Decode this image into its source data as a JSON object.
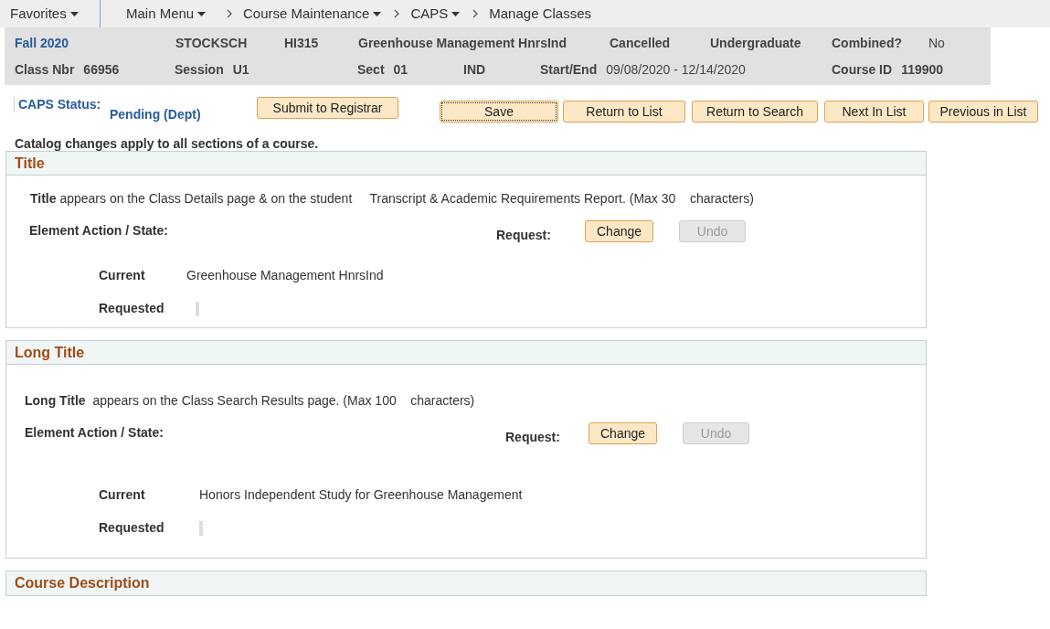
{
  "nav": {
    "items": [
      {
        "label": "Favorites",
        "dropdown": true,
        "breadcrumb": false
      },
      {
        "label": "Main Menu",
        "dropdown": true,
        "breadcrumb": false
      },
      {
        "label": "Course Maintenance",
        "dropdown": true,
        "breadcrumb": true
      },
      {
        "label": "CAPS",
        "dropdown": true,
        "breadcrumb": true
      },
      {
        "label": "Manage Classes",
        "dropdown": false,
        "breadcrumb": true
      }
    ]
  },
  "class_header": {
    "row_1": [
      {
        "value": "Fall 2020",
        "kind": "term"
      },
      {
        "value": "STOCKSCH",
        "kind": "bold"
      },
      {
        "value": "HI315",
        "kind": "bold"
      },
      {
        "value": "Greenhouse Management HnrsInd",
        "kind": "bold"
      },
      {
        "value": "Cancelled",
        "kind": "bold"
      },
      {
        "value": "Undergraduate",
        "kind": "bold"
      },
      {
        "value": "Combined?",
        "kind": "bold"
      },
      {
        "value": "No",
        "kind": "plain"
      }
    ],
    "row_2": [
      {
        "label": "Class Nbr",
        "value": "66956"
      },
      {
        "label": "Session",
        "value": "U1"
      },
      {
        "label": "Sect",
        "value": "01"
      },
      {
        "value": "IND"
      },
      {
        "label": "Start/End",
        "value": "09/08/2020 - 12/14/2020"
      },
      {
        "label": "Course ID",
        "value": "119900"
      }
    ]
  },
  "caps_status": {
    "label": "CAPS Status:",
    "value": "Pending (Dept)"
  },
  "action_buttons": [
    {
      "label": "Submit to Registrar",
      "focused": false
    },
    {
      "label": "Save",
      "focused": true
    },
    {
      "label": "Return to List",
      "focused": false
    },
    {
      "label": "Return to Search",
      "focused": false
    },
    {
      "label": "Next In List",
      "focused": false
    },
    {
      "label": "Previous in List",
      "focused": false
    }
  ],
  "note": "Catalog changes apply to all sections of a course.",
  "sections": [
    {
      "title": "Title",
      "description": "**Title** appears on the Class Details page & on the student     Transcript & Academic Requirements Report. (Max 30    characters)",
      "element_action_label": "Element Action / State:",
      "request_label": "Request:",
      "change_button": {
        "label": "Change",
        "disabled": false
      },
      "undo_button": {
        "label": "Undo",
        "disabled": true
      },
      "current_label": "Current",
      "current_value": "Greenhouse Management HnrsInd",
      "requested_label": "Requested"
    },
    {
      "title": "Long Title",
      "description": "**Long Title**  appears on the Class Search Results page. (Max 100    characters)",
      "element_action_label": "Element Action / State:",
      "request_label": "Request:",
      "change_button": {
        "label": "Change",
        "disabled": false
      },
      "undo_button": {
        "label": "Undo",
        "disabled": true
      },
      "current_label": "Current",
      "current_value": "Honors Independent Study for Greenhouse Management",
      "requested_label": "Requested"
    },
    {
      "title": "Course Description"
    }
  ]
}
